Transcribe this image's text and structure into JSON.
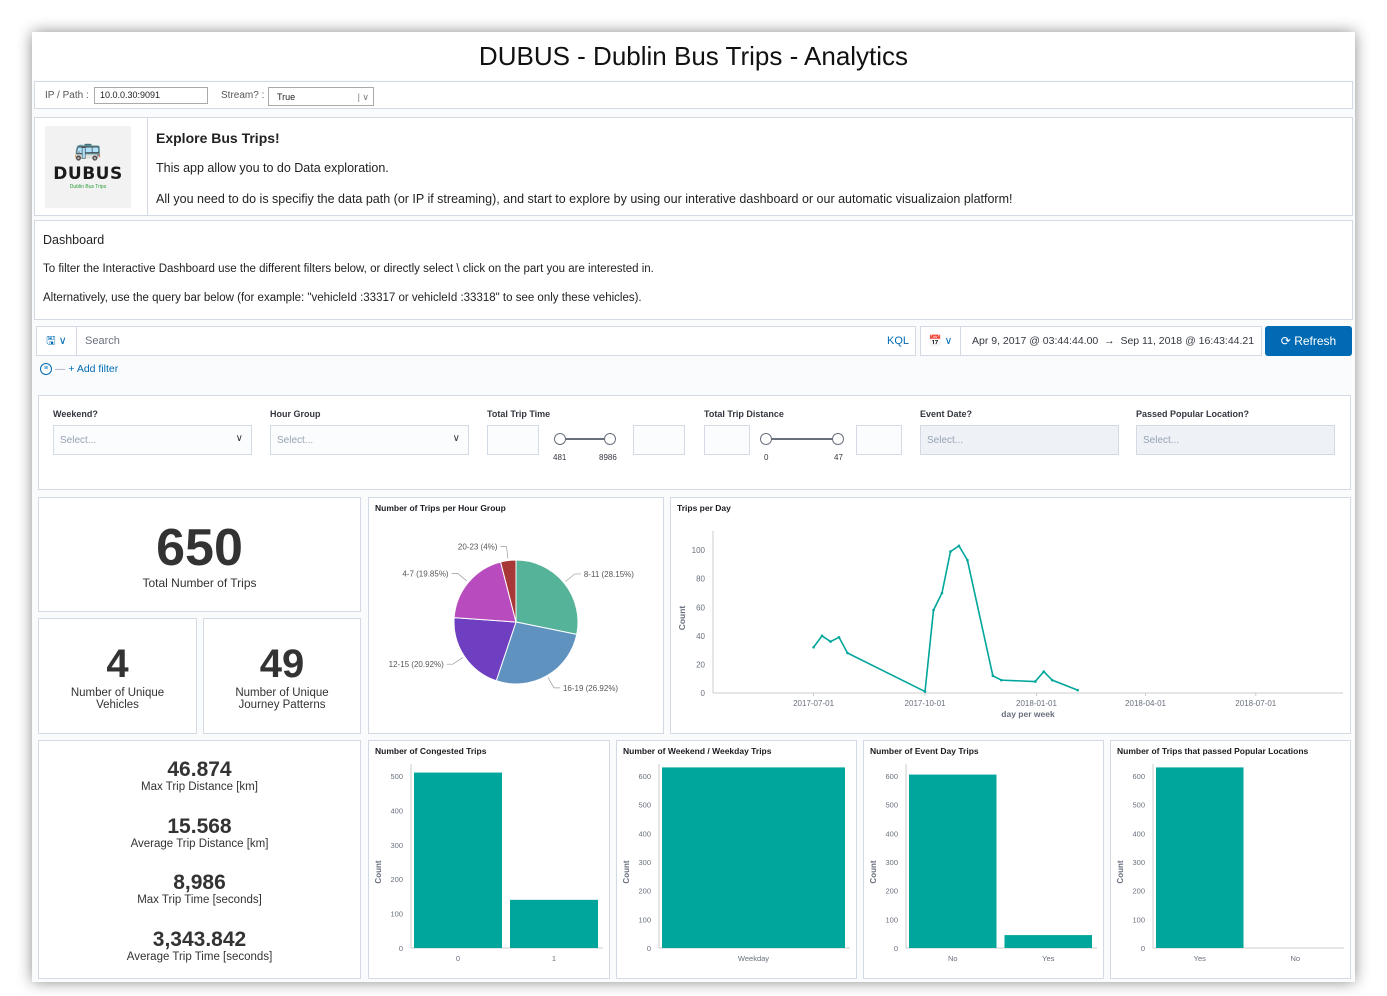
{
  "app_title": "DUBUS - Dublin Bus Trips - Analytics",
  "config": {
    "ip_label": "IP / Path :",
    "ip_value": "10.0.0.30:9091",
    "stream_label": "Stream? :",
    "stream_value": "True"
  },
  "intro": {
    "logo_brand": "DUBUS",
    "logo_tagline": "Dublin Bus Trips",
    "heading": "Explore Bus Trips!",
    "line1": "This app allow you to do Data exploration.",
    "line2": "All you need to do is specifiy the data path (or IP if streaming), and start to explore by using our interative dashboard or our automatic visualizaion platform!"
  },
  "dashboard_desc": {
    "heading": "Dashboard",
    "line1": "To filter the Interactive Dashboard use the different filters below, or directly select \\ click on the part you are interested in.",
    "line2": "Alternatively, use the query bar below (for example: \"vehicleId :33317 or vehicleId :33318\" to see only these vehicles)."
  },
  "query": {
    "placeholder": "Search",
    "language": "KQL",
    "date_from": "Apr 9, 2017 @ 03:44:44.00",
    "arrow": "→",
    "date_to": "Sep 11, 2018 @ 16:43:44.21",
    "refresh_label": "Refresh",
    "add_filter": "+ Add filter"
  },
  "controls": {
    "weekend": {
      "label": "Weekend?",
      "placeholder": "Select..."
    },
    "hour_group": {
      "label": "Hour Group",
      "placeholder": "Select..."
    },
    "trip_time": {
      "label": "Total Trip Time",
      "min": "481",
      "max": "8986"
    },
    "trip_distance": {
      "label": "Total Trip Distance",
      "min": "0",
      "max": "47"
    },
    "event_date": {
      "label": "Event Date?",
      "placeholder": "Select..."
    },
    "popular_location": {
      "label": "Passed Popular Location?",
      "placeholder": "Select..."
    }
  },
  "metrics": {
    "total_trips": {
      "value": "650",
      "label": "Total Number of Trips"
    },
    "unique_vehicles": {
      "value": "4",
      "label1": "Number of Unique",
      "label2": "Vehicles"
    },
    "unique_patterns": {
      "value": "49",
      "label1": "Number of Unique",
      "label2": "Journey Patterns"
    },
    "max_distance": {
      "value": "46.874",
      "label": "Max Trip Distance [km]"
    },
    "avg_distance": {
      "value": "15.568",
      "label": "Average Trip Distance [km]"
    },
    "max_time": {
      "value": "8,986",
      "label": "Max Trip Time [seconds]"
    },
    "avg_time": {
      "value": "3,343.842",
      "label": "Average Trip Time [seconds]"
    }
  },
  "colors": {
    "accent": "#006bb4",
    "teal": "#00a69b",
    "pie": [
      "#54b399",
      "#6092c0",
      "#6f3fc1",
      "#b84cbf",
      "#a83838"
    ]
  },
  "chart_data": [
    {
      "type": "pie",
      "title": "Number of Trips per Hour Group",
      "slices": [
        {
          "label": "8-11 (28.15%)",
          "value": 28.15
        },
        {
          "label": "16-19 (26.92%)",
          "value": 26.92
        },
        {
          "label": "12-15 (20.92%)",
          "value": 20.92
        },
        {
          "label": "4-7 (19.85%)",
          "value": 19.85
        },
        {
          "label": "20-23 (4%)",
          "value": 4
        }
      ]
    },
    {
      "type": "line",
      "title": "Trips per Day",
      "xlabel": "day per week",
      "ylabel": "Count",
      "ylim": [
        0,
        105
      ],
      "xticks": [
        "2017-07-01",
        "2017-10-01",
        "2018-01-01",
        "2018-04-01",
        "2018-07-01"
      ],
      "yticks": [
        0,
        20,
        40,
        60,
        80,
        100
      ],
      "points": [
        {
          "x": "2017-07-01",
          "y": 32
        },
        {
          "x": "2017-07-08",
          "y": 40
        },
        {
          "x": "2017-07-15",
          "y": 36
        },
        {
          "x": "2017-07-22",
          "y": 39
        },
        {
          "x": "2017-07-29",
          "y": 28
        },
        {
          "x": "2017-10-01",
          "y": 1
        },
        {
          "x": "2017-10-08",
          "y": 58
        },
        {
          "x": "2017-10-15",
          "y": 70
        },
        {
          "x": "2017-10-22",
          "y": 99
        },
        {
          "x": "2017-10-29",
          "y": 103
        },
        {
          "x": "2017-11-05",
          "y": 93
        },
        {
          "x": "2017-11-26",
          "y": 12
        },
        {
          "x": "2017-12-03",
          "y": 9
        },
        {
          "x": "2017-12-31",
          "y": 8
        },
        {
          "x": "2018-01-07",
          "y": 15
        },
        {
          "x": "2018-01-14",
          "y": 9
        },
        {
          "x": "2018-02-04",
          "y": 2
        }
      ]
    },
    {
      "type": "bar",
      "title": "Number of Congested Trips",
      "ylabel": "Count",
      "ylim": [
        0,
        500
      ],
      "yticks": [
        0,
        100,
        200,
        300,
        400,
        500
      ],
      "categories": [
        "0",
        "1"
      ],
      "values": [
        510,
        140
      ]
    },
    {
      "type": "bar",
      "title": "Number of Weekend / Weekday Trips",
      "ylabel": "Count",
      "ylim": [
        0,
        600
      ],
      "yticks": [
        0,
        100,
        200,
        300,
        400,
        500,
        600
      ],
      "categories": [
        "Weekday"
      ],
      "values": [
        650
      ]
    },
    {
      "type": "bar",
      "title": "Number of Event Day Trips",
      "ylabel": "Count",
      "ylim": [
        0,
        600
      ],
      "yticks": [
        0,
        100,
        200,
        300,
        400,
        500,
        600
      ],
      "categories": [
        "No",
        "Yes"
      ],
      "values": [
        605,
        45
      ]
    },
    {
      "type": "bar",
      "title": "Number of Trips that passed Popular Locations",
      "ylabel": "Count",
      "ylim": [
        0,
        600
      ],
      "yticks": [
        0,
        100,
        200,
        300,
        400,
        500,
        600
      ],
      "categories": [
        "Yes",
        "No"
      ],
      "values": [
        650,
        0
      ]
    }
  ]
}
